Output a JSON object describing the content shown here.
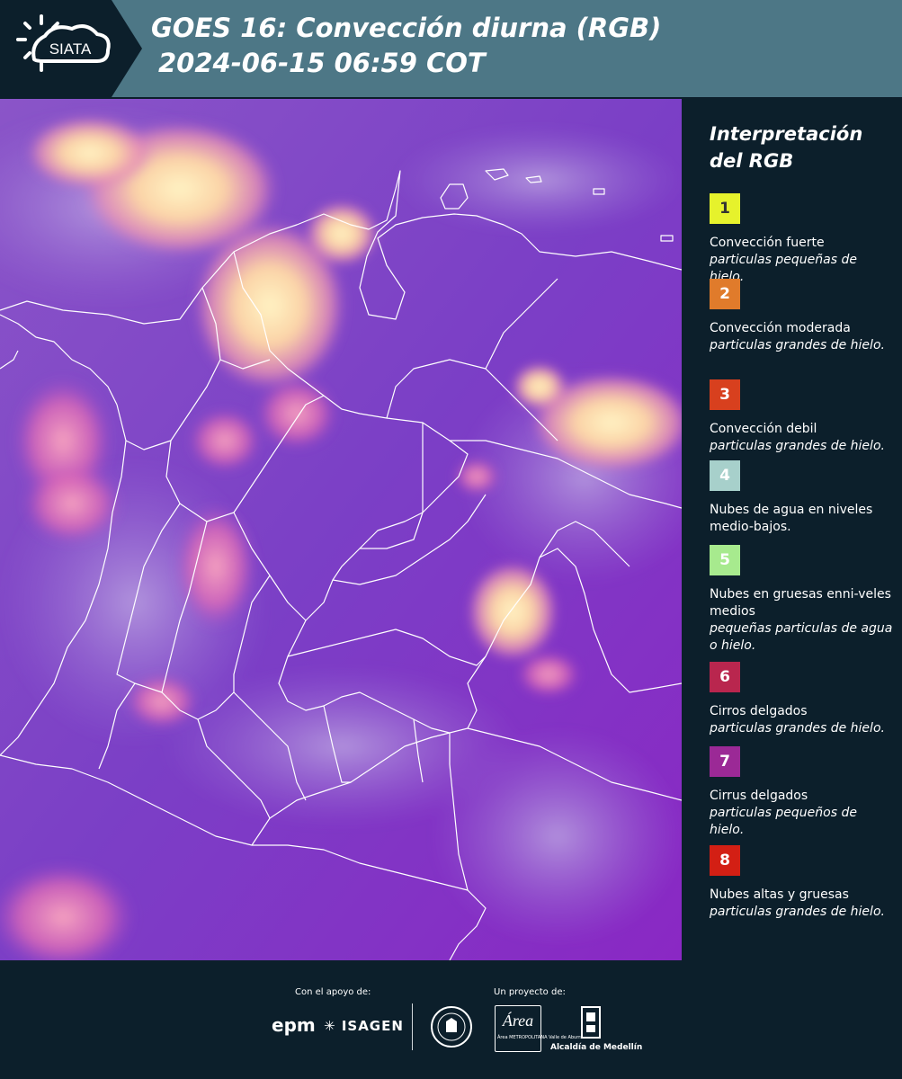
{
  "header": {
    "logo_text": "SIATA",
    "title_line1": "GOES 16: Convección diurna (RGB)",
    "title_line2": "2024-06-15 06:59 COT",
    "background_color": "#4d7786",
    "logo_panel_color": "#0c1f2b"
  },
  "map": {
    "background_color": "#7a30c4"
  },
  "legend": {
    "title": "Interpretación del RGB",
    "items": [
      {
        "number": "1",
        "color": "#e6f22c",
        "text_color": "#333333",
        "label": "Convección fuerte",
        "sub": "particulas pequeñas de hielo."
      },
      {
        "number": "2",
        "color": "#e07b2b",
        "text_color": "#ffffff",
        "label": "Convección moderada",
        "sub": "particulas grandes de hielo."
      },
      {
        "number": "3",
        "color": "#d8401e",
        "text_color": "#ffffff",
        "label": "Convección debil",
        "sub": "particulas grandes de hielo."
      },
      {
        "number": "4",
        "color": "#a7d0cb",
        "text_color": "#ffffff",
        "label": "Nubes de agua en niveles medio-bajos.",
        "sub": ""
      },
      {
        "number": "5",
        "color": "#a7ea8e",
        "text_color": "#ffffff",
        "label": "Nubes en gruesas enni-veles medios",
        "sub": "pequeñas particulas de agua o hielo."
      },
      {
        "number": "6",
        "color": "#b9264e",
        "text_color": "#ffffff",
        "label": "Cirros delgados",
        "sub": "particulas grandes de hielo."
      },
      {
        "number": "7",
        "color": "#9b2996",
        "text_color": "#ffffff",
        "label": "Cirrus delgados",
        "sub": "particulas pequeños de hielo."
      },
      {
        "number": "8",
        "color": "#d31f14",
        "text_color": "#ffffff",
        "label": "Nubes altas y gruesas",
        "sub": "particulas grandes de hielo."
      }
    ]
  },
  "footer": {
    "support_label": "Con el apoyo de:",
    "project_label": "Un proyecto de:",
    "sponsor_1": "epm",
    "sponsor_2": "ISAGEN",
    "partner_area": "Área METROPOLITANA Valle de Aburrá",
    "partner_alcaldia": "Alcaldía de Medellín"
  }
}
